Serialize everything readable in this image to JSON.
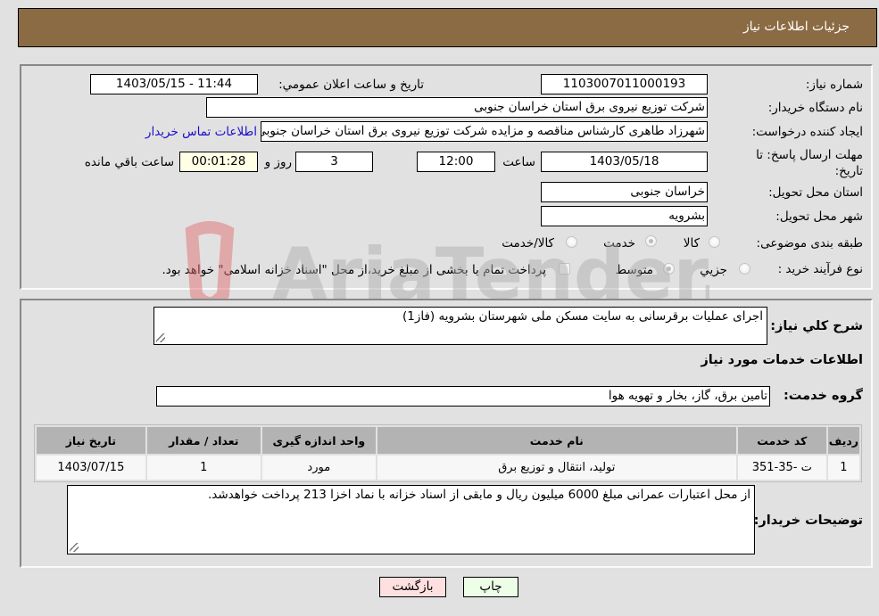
{
  "header": {
    "title": "جزئیات اطلاعات نیاز"
  },
  "form": {
    "need_number": {
      "label": "شماره نیاز:",
      "value": "1103007011000193"
    },
    "announce_datetime": {
      "label": "تاریخ و ساعت اعلان عمومي:",
      "value": "1403/05/15 - 11:44"
    },
    "buyer_org": {
      "label": "نام دستگاه خريدار:",
      "value": "شرکت توزیع نیروی برق استان خراسان جنوبی"
    },
    "requester": {
      "label": "ایجاد کننده درخواست:",
      "value": "شهرزاد طاهری کارشناس مناقصه و مزایده شرکت توزیع نیروی برق استان خراسان جنوبی"
    },
    "buyer_contact_link": "اطلاعات تماس خریدار",
    "deadline": {
      "label": "مهلت ارسال پاسخ: تا تاریخ:",
      "date": "1403/05/18",
      "time_label": "ساعت",
      "time": "12:00",
      "days": "3",
      "days_label": "روز و",
      "remaining": "00:01:28",
      "remaining_label": "ساعت باقي مانده"
    },
    "delivery_province": {
      "label": "استان محل تحویل:",
      "value": "خراسان جنوبی"
    },
    "delivery_city": {
      "label": "شهر محل تحویل:",
      "value": "بشرویه"
    },
    "category": {
      "label": "طبقه بندی موضوعی:",
      "options": [
        "کالا",
        "خدمت",
        "کالا/خدمت"
      ],
      "selected": "خدمت"
    },
    "purchase_type": {
      "label": "نوع فرآیند خرید :",
      "options": [
        "جزيي",
        "متوسط"
      ],
      "selected": "متوسط",
      "treasury_note": "پرداخت تمام یا بخشی از مبلغ خرید،از محل \"اسناد خزانه اسلامی\" خواهد بود."
    }
  },
  "description": {
    "label": "شرح کلي نياز:",
    "value": "اجرای عملیات برقرسانی به سایت مسکن ملی شهرستان بشرویه (فاز1)"
  },
  "services_section": {
    "title": "اطلاعات خدمات مورد نياز",
    "group_label": "گروه خدمت:",
    "group_value": "تامین برق، گاز، بخار و تهویه هوا",
    "table": {
      "headers": [
        "رديف",
        "کد خدمت",
        "نام خدمت",
        "واحد اندازه گيری",
        "تعداد / مقدار",
        "تاريخ نياز"
      ],
      "rows": [
        [
          "1",
          "ت -35-351",
          "تولید، انتقال و توزیع برق",
          "مورد",
          "1",
          "1403/07/15"
        ]
      ]
    }
  },
  "buyer_notes": {
    "label": "توضيحات خريدار:",
    "value": "از محل اعتبارات عمرانی مبلغ 6000 میلیون ریال و مابقی از اسناد خزانه با نماد اخزا 213 پرداخت خواهدشد."
  },
  "buttons": {
    "print": "چاپ",
    "back": "بازگشت"
  },
  "watermark": {
    "text": "AriaTender.neT"
  },
  "colors": {
    "header_bg": "#8b6b43",
    "back_btn": "#ffe0e0",
    "print_btn": "#ecffe6",
    "link": "#1a0dcc"
  }
}
